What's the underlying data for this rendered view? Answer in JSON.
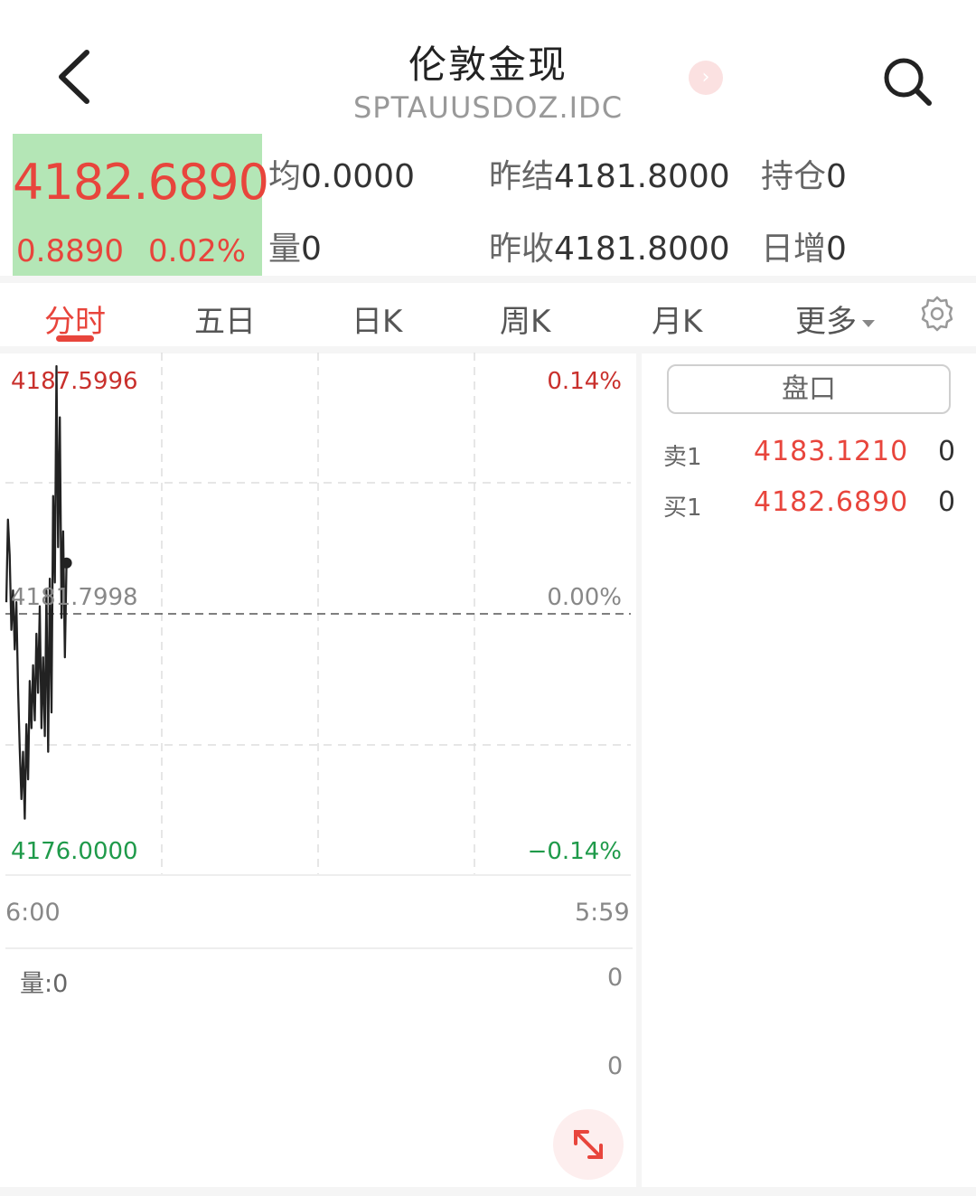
{
  "header": {
    "title": "伦敦金现",
    "subtitle": "SPTAUUSDOZ.IDC",
    "next_icon": "chevron-right-icon",
    "back_icon": "chevron-left-icon",
    "search_icon": "search-icon"
  },
  "quote": {
    "price": "4182.6890",
    "change": "0.8890",
    "change_pct": "0.02%",
    "price_bg_color": "#b4e6b6",
    "up_color": "#e8453c",
    "down_color": "#1f9a4a",
    "stats": {
      "avg_label": "均",
      "avg_value": "0.0000",
      "prev_settle_label": "昨结",
      "prev_settle_value": "4181.8000",
      "position_label": "持仓",
      "position_value": "0",
      "volume_label": "量",
      "volume_value": "0",
      "prev_close_label": "昨收",
      "prev_close_value": "4181.8000",
      "daily_inc_label": "日增",
      "daily_inc_value": "0"
    }
  },
  "tabs": [
    {
      "label": "分时",
      "active": true
    },
    {
      "label": "五日"
    },
    {
      "label": "日K"
    },
    {
      "label": "周K"
    },
    {
      "label": "月K"
    },
    {
      "label": "更多"
    }
  ],
  "settings_icon": "gear-icon",
  "chart": {
    "top_price": "4187.5996",
    "mid_price": "4181.7998",
    "bottom_price": "4176.0000",
    "top_pct": "0.14%",
    "mid_pct": "0.00%",
    "bottom_pct": "−0.14%",
    "start_time": "6:00",
    "end_time": "5:59",
    "volume_label": "量:0",
    "volume_top": "0",
    "volume_bottom": "0"
  },
  "chart_data": {
    "type": "line",
    "ylim": [
      4176.0,
      4187.5996
    ],
    "baseline": 4181.7998,
    "x_range": [
      "6:00",
      "5:59"
    ],
    "series": [
      {
        "values": [
          4181.6,
          4183.7,
          4182.8,
          4180.9,
          4181.9,
          4180.4,
          4181.6,
          4179.4,
          4177.9,
          4176.6,
          4177.8,
          4176.1,
          4178.5,
          4177.1,
          4179.6,
          4178.4,
          4180.0,
          4178.6,
          4180.8,
          4179.3,
          4181.5,
          4178.4,
          4180.2,
          4178.2,
          4181.9,
          4177.8,
          4182.2,
          4178.8,
          4184.3,
          4182.1,
          4187.6,
          4183.0,
          4186.3,
          4181.2,
          4183.4,
          4180.2,
          4182.6
        ]
      }
    ]
  },
  "order_book": {
    "title": "盘口",
    "rows": [
      {
        "label": "卖1",
        "price": "4183.1210",
        "vol": "0"
      },
      {
        "label": "买1",
        "price": "4182.6890",
        "vol": "0"
      }
    ]
  },
  "expand_icon": "expand-icon"
}
